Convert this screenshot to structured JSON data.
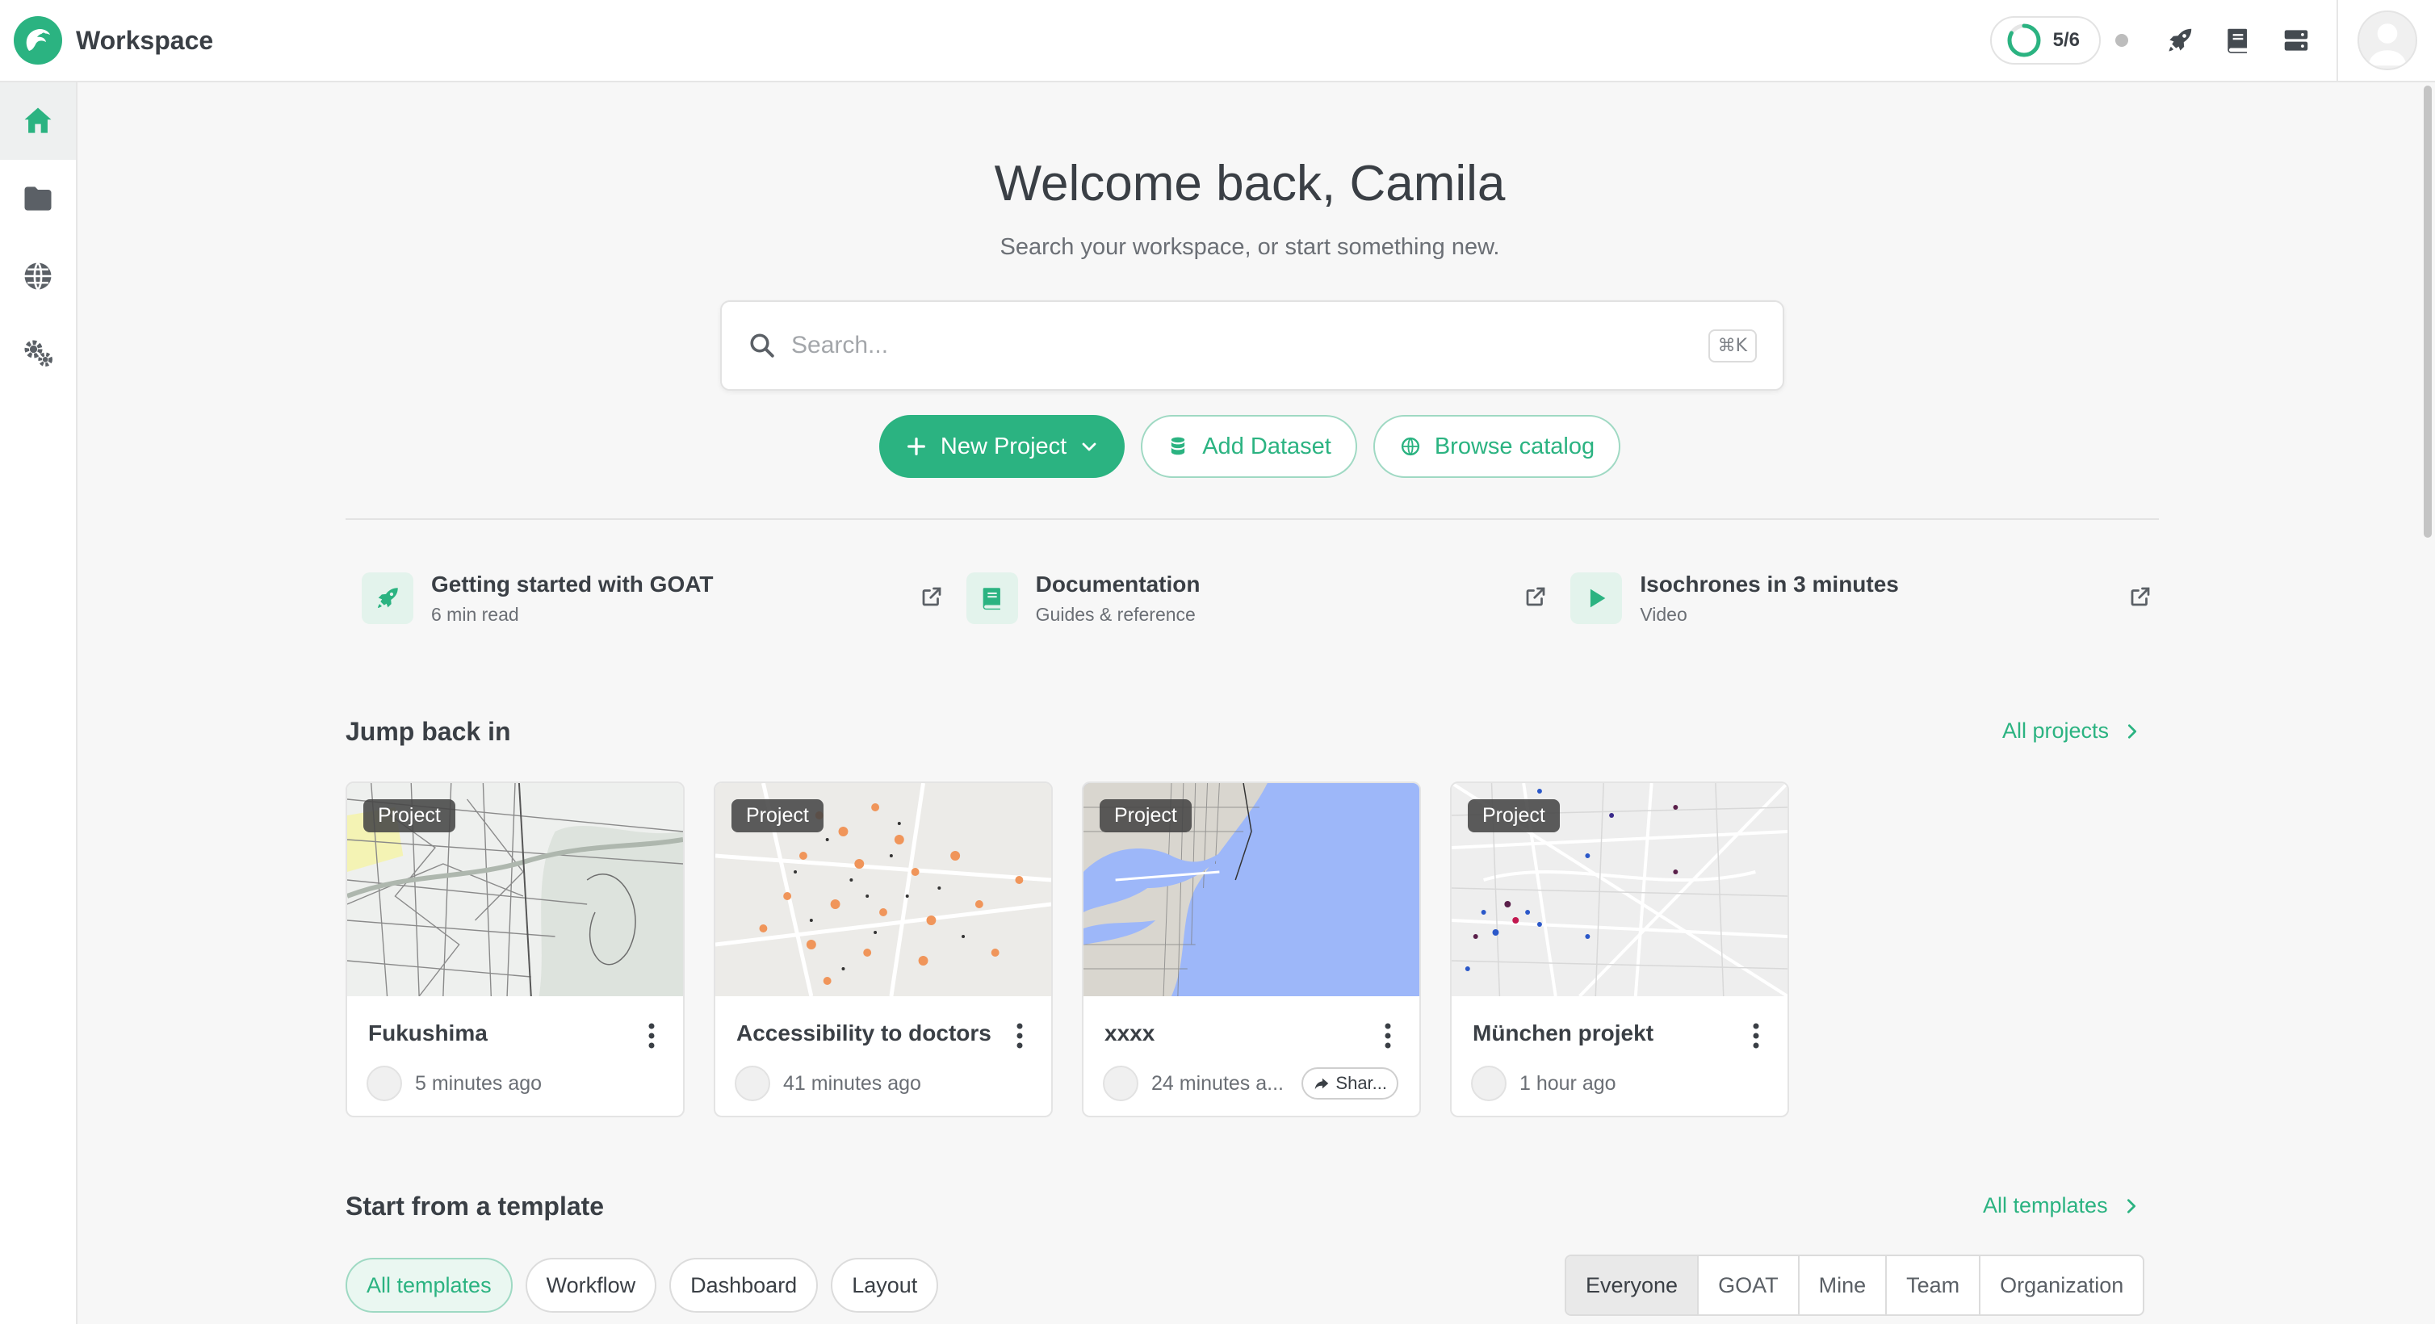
{
  "app": {
    "title": "Workspace"
  },
  "header": {
    "progress": "5/6",
    "progress_fraction": 0.833
  },
  "sidebar": {
    "items": [
      {
        "name": "home",
        "icon": "home-icon",
        "active": true
      },
      {
        "name": "folder",
        "icon": "folder-icon",
        "active": false
      },
      {
        "name": "catalog",
        "icon": "globe-icon",
        "active": false
      },
      {
        "name": "settings",
        "icon": "gears-icon",
        "active": false
      }
    ]
  },
  "welcome": {
    "title": "Welcome back, Camila",
    "subtitle": "Search your workspace, or start something new."
  },
  "search": {
    "placeholder": "Search...",
    "shortcut": "⌘K"
  },
  "actions": {
    "new_project": "New Project",
    "add_dataset": "Add Dataset",
    "browse_catalog": "Browse catalog"
  },
  "resources": [
    {
      "title": "Getting started with GOAT",
      "subtitle": "6 min read",
      "icon": "rocket-icon"
    },
    {
      "title": "Documentation",
      "subtitle": "Guides & reference",
      "icon": "book-icon"
    },
    {
      "title": "Isochrones in 3 minutes",
      "subtitle": "Video",
      "icon": "play-icon"
    }
  ],
  "recent": {
    "title": "Jump back in",
    "link": "All projects",
    "projects": [
      {
        "badge": "Project",
        "name": "Fukushima",
        "time": "5 minutes ago"
      },
      {
        "badge": "Project",
        "name": "Accessibility to doctors",
        "time": "41 minutes ago"
      },
      {
        "badge": "Project",
        "name": "xxxx",
        "time": "24 minutes a...",
        "shared": "Shar..."
      },
      {
        "badge": "Project",
        "name": "München projekt",
        "time": "1 hour ago"
      }
    ]
  },
  "templates": {
    "title": "Start from a template",
    "link": "All templates",
    "filters": [
      "All templates",
      "Workflow",
      "Dashboard",
      "Layout"
    ],
    "owners": [
      "Everyone",
      "GOAT",
      "Mine",
      "Team",
      "Organization"
    ]
  },
  "colors": {
    "accent": "#2bb381",
    "accent_light": "#e3f3ec",
    "water": "#9db7f9"
  }
}
